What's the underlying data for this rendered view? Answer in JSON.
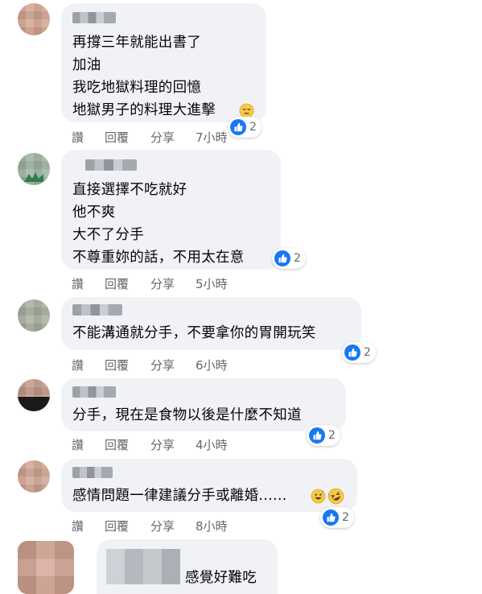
{
  "actions": {
    "like": "讚",
    "reply": "回覆",
    "share": "分享"
  },
  "comments": [
    {
      "lines": [
        "再撐三年就能出書了",
        "加油",
        "我吃地獄料理的回憶",
        "地獄男子的料理大進擊"
      ],
      "time": "7小時",
      "likes": "2",
      "emoji": "expressionless-face-icon"
    },
    {
      "lines": [
        "直接選擇不吃就好",
        "他不爽",
        "大不了分手",
        "不尊重妳的話，不用太在意"
      ],
      "time": "5小時",
      "likes": "2"
    },
    {
      "lines": [
        "不能溝通就分手，不要拿你的胃開玩笑"
      ],
      "time": "6小時",
      "likes": "2"
    },
    {
      "lines": [
        "分手，現在是食物以後是什麼不知道"
      ],
      "time": "4小時",
      "likes": "2"
    },
    {
      "lines": [
        "感情問題一律建議分手或離婚......"
      ],
      "time": "8小時",
      "likes": "2",
      "emoji": "grinning-sweat-and-rofl-icons"
    },
    {
      "lines": [
        "感覺好難吃"
      ]
    }
  ],
  "colors": {
    "bubble": "#f0f2f5",
    "like_blue": "#1877f2",
    "meta_gray": "#65676b"
  }
}
